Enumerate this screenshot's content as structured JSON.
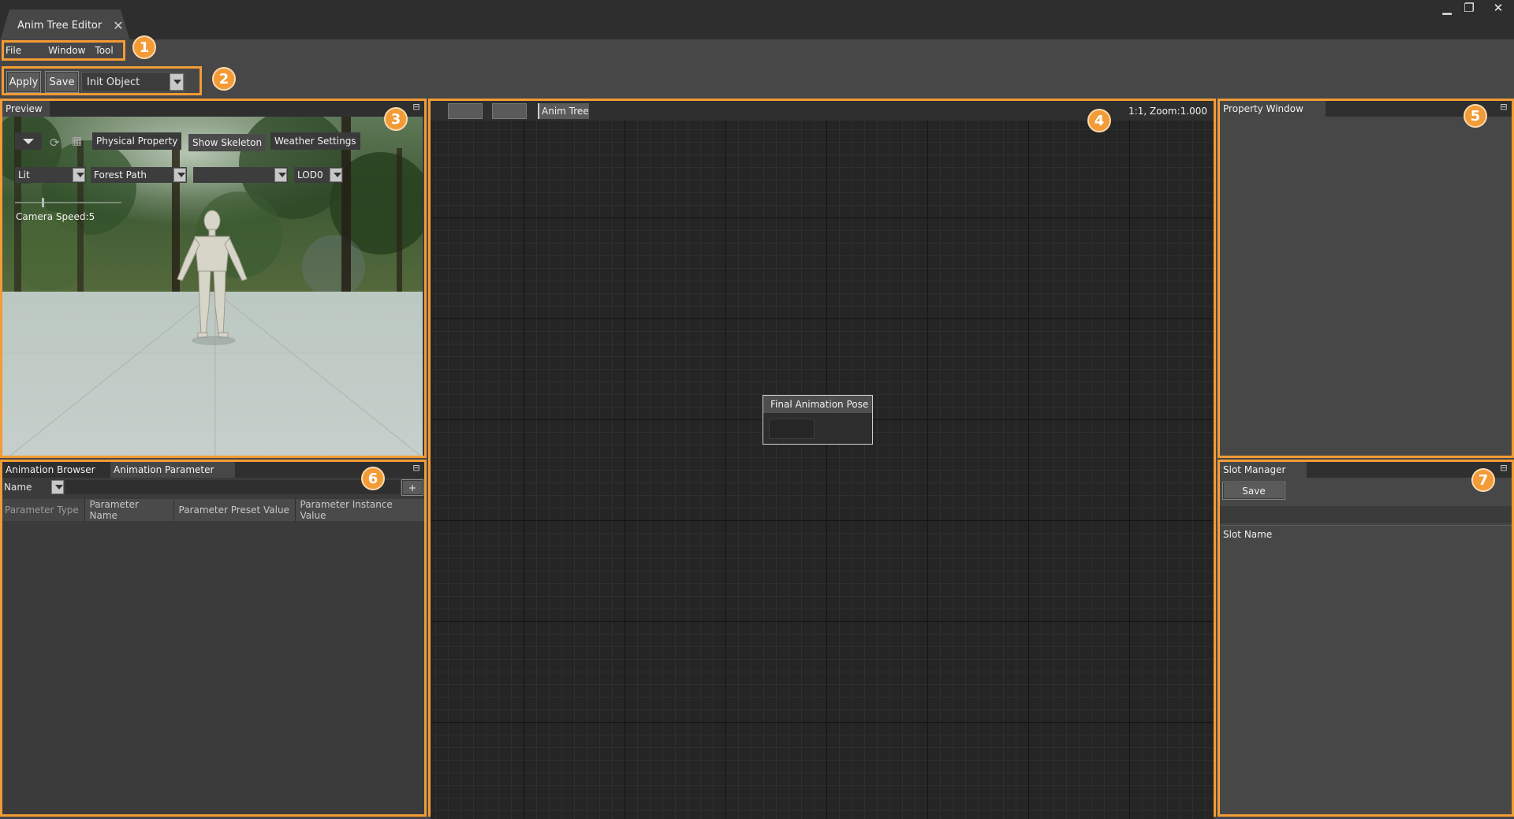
{
  "window": {
    "tab_title": "Anim Tree Editor",
    "tab_close": "✕",
    "minimize": "▁",
    "restore": "❐",
    "close": "✕"
  },
  "menu": {
    "file": "File",
    "window": "Window",
    "tool": "Tool"
  },
  "toolbar": {
    "apply": "Apply",
    "save": "Save",
    "object_select": "Init Object"
  },
  "badges": [
    "1",
    "2",
    "3",
    "4",
    "5",
    "6",
    "7"
  ],
  "preview": {
    "tab": "Preview",
    "physical_property": "Physical Property",
    "show_skeleton": "Show Skeleton",
    "weather_settings": "Weather Settings",
    "lit": "Lit",
    "environment": "Forest Path",
    "empty_select": "",
    "lod": "LOD0",
    "camera_speed": "Camera Speed:5",
    "camera_speed_value": 5
  },
  "graph": {
    "tab": "Anim Tree",
    "zoom": "1:1, Zoom:1.000",
    "node_title": "Final Animation Pose"
  },
  "property_window": {
    "tab": "Property Window"
  },
  "animation": {
    "tab_browser": "Animation Browser",
    "tab_parameter": "Animation Parameter",
    "filter": "Name",
    "add": "+",
    "columns": [
      "Parameter Type",
      "Parameter Name",
      "Parameter Preset Value",
      "Parameter Instance Value"
    ]
  },
  "slot_manager": {
    "tab": "Slot Manager",
    "save": "Save",
    "column": "Slot Name"
  },
  "colors": {
    "highlight": "#f39b36",
    "panel_bg": "#3b3b3b",
    "graph_bg": "#252525"
  }
}
